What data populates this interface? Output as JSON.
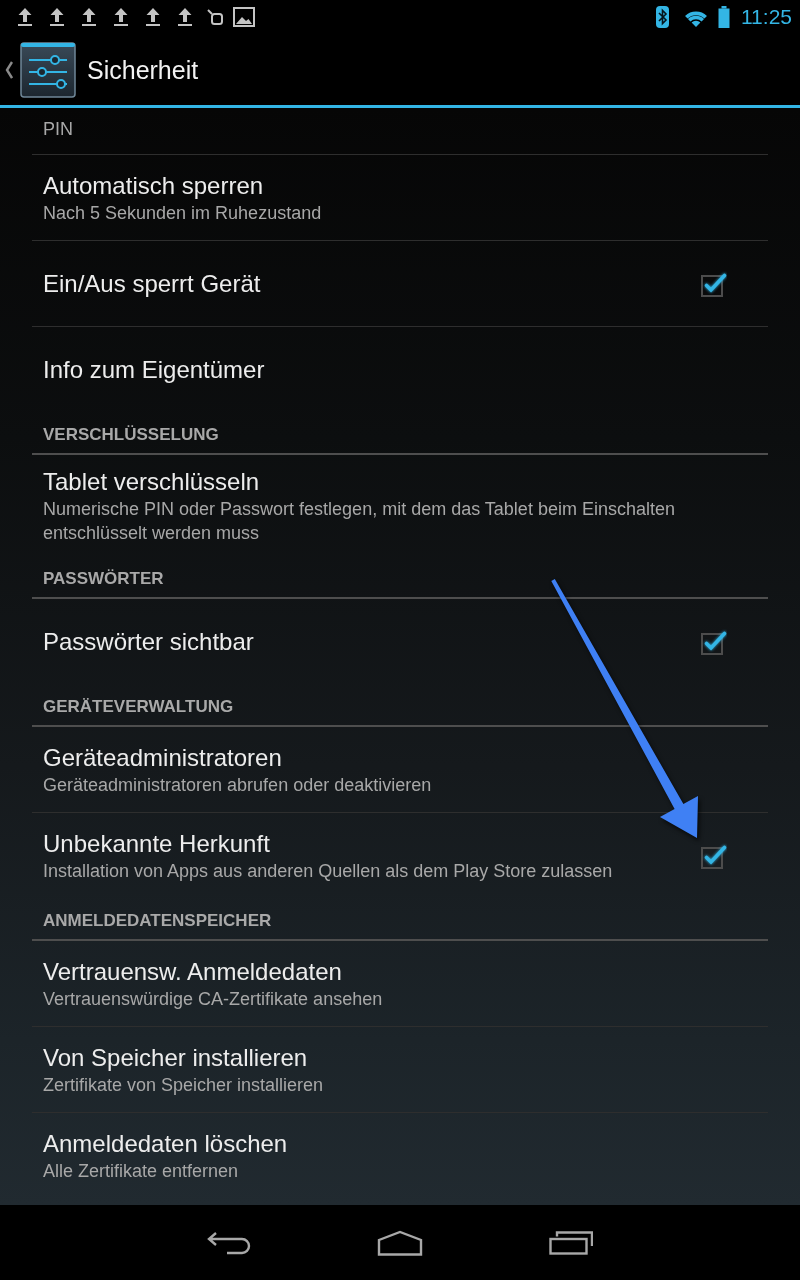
{
  "status_bar": {
    "time": "11:25"
  },
  "action_bar": {
    "title": "Sicherheit"
  },
  "settings": [
    {
      "kind": "preference",
      "summary": "PIN"
    },
    {
      "kind": "preference",
      "title": "Automatisch sperren",
      "summary": "Nach 5 Sekunden im Ruhezustand"
    },
    {
      "kind": "checkbox",
      "title": "Ein/Aus sperrt Gerät",
      "checked": true
    },
    {
      "kind": "preference",
      "title": "Info zum Eigentümer"
    },
    {
      "kind": "category",
      "title": "VERSCHLÜSSELUNG"
    },
    {
      "kind": "preference",
      "title": "Tablet verschlüsseln",
      "summary": "Numerische PIN oder Passwort festlegen, mit dem das Tablet beim Einschalten entschlüsselt werden muss"
    },
    {
      "kind": "category",
      "title": "PASSWÖRTER"
    },
    {
      "kind": "checkbox",
      "title": "Passwörter sichtbar",
      "checked": true
    },
    {
      "kind": "category",
      "title": "GERÄTEVERWALTUNG"
    },
    {
      "kind": "preference",
      "title": "Geräteadministratoren",
      "summary": "Geräteadministratoren abrufen oder deaktivieren"
    },
    {
      "kind": "checkbox",
      "title": "Unbekannte Herkunft",
      "summary": "Installation von Apps aus anderen Quellen als dem Play Store zulassen",
      "checked": true
    },
    {
      "kind": "category",
      "title": "ANMELDEDATENSPEICHER"
    },
    {
      "kind": "preference",
      "title": "Vertrauensw. Anmeldedaten",
      "summary": "Vertrauenswürdige CA-Zertifikate ansehen"
    },
    {
      "kind": "preference",
      "title": "Von Speicher installieren",
      "summary": "Zertifikate von Speicher installieren"
    },
    {
      "kind": "preference",
      "title": "Anmeldedaten löschen",
      "summary": "Alle Zertifikate entfernen"
    }
  ],
  "annotations": [
    {
      "kind": "arrow"
    }
  ]
}
